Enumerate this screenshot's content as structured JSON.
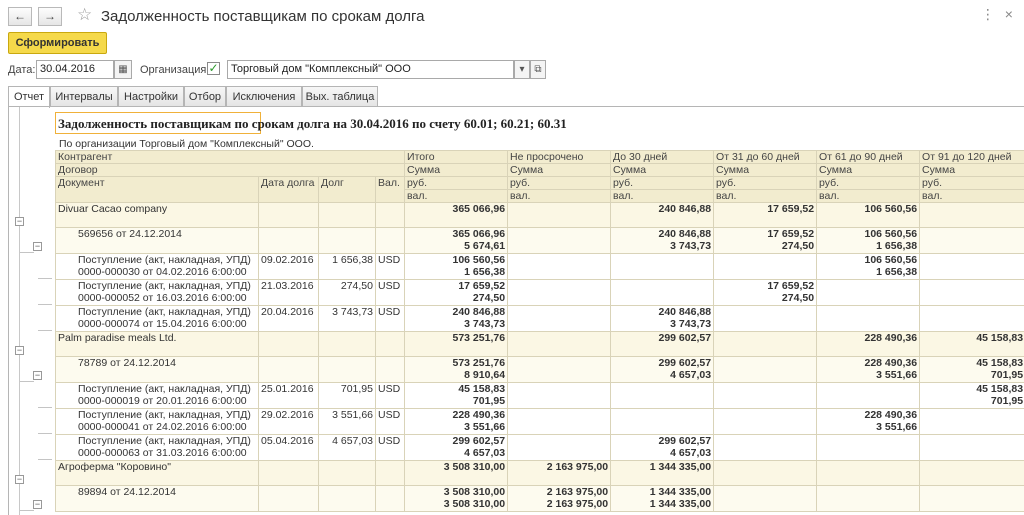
{
  "window": {
    "back_icon": "arrow-left-icon",
    "fwd_icon": "arrow-right-icon",
    "title": "Задолженность поставщикам по срокам долга"
  },
  "toolbar": {
    "generate_label": "Сформировать"
  },
  "filters": {
    "date_label": "Дата:",
    "date_value": "30.04.2016",
    "org_label": "Организация:",
    "org_value": "Торговый дом \"Комплексный\" ООО"
  },
  "tabs": [
    "Отчет",
    "Интервалы",
    "Настройки",
    "Отбор",
    "Исключения",
    "Вых. таблица"
  ],
  "report": {
    "title": "Задолженность поставщикам по срокам долга на 30.04.2016  по счету 60.01; 60.21; 60.31",
    "subtitle": "По организации Торговый дом \"Комплексный\" ООО.",
    "header": {
      "row1": [
        "Контрагент",
        "Итого",
        "Не просрочено",
        "До 30 дней",
        "От 31 до 60 дней",
        "От 61 до 90 дней",
        "От 91 до 120 дней"
      ],
      "row2": [
        "Договор",
        "Сумма",
        "Сумма",
        "Сумма",
        "Сумма",
        "Сумма",
        "Сумма"
      ],
      "row3": [
        "Документ",
        "Дата долга",
        "Долг",
        "Вал.",
        "руб.",
        "руб.",
        "руб.",
        "руб.",
        "руб.",
        "руб."
      ],
      "row4": [
        "вал.",
        "вал.",
        "вал.",
        "вал.",
        "вал.",
        "вал."
      ]
    },
    "rows": [
      {
        "t": "g1",
        "c": [
          "Divuar Cacao company",
          "",
          "",
          "",
          "365 066,96",
          "",
          "240 846,88",
          "17 659,52",
          "106 560,56",
          ""
        ]
      },
      {
        "t": "g2",
        "c": [
          "569656 от 24.12.2014",
          "",
          "",
          "",
          "365 066,96\n5 674,61",
          "",
          "240 846,88\n3 743,73",
          "17 659,52\n274,50",
          "106 560,56\n1 656,38",
          ""
        ]
      },
      {
        "t": "d",
        "c": [
          "Поступление (акт, накладная, УПД)\n0000-000030 от 04.02.2016 6:00:00",
          "09.02.2016",
          "1 656,38",
          "USD",
          "106 560,56\n1 656,38",
          "",
          "",
          "",
          "106 560,56\n1 656,38",
          ""
        ]
      },
      {
        "t": "d",
        "c": [
          "Поступление (акт, накладная, УПД)\n0000-000052 от 16.03.2016 6:00:00",
          "21.03.2016",
          "274,50",
          "USD",
          "17 659,52\n274,50",
          "",
          "",
          "17 659,52\n274,50",
          "",
          ""
        ]
      },
      {
        "t": "d",
        "c": [
          "Поступление (акт, накладная, УПД)\n0000-000074 от 15.04.2016 6:00:00",
          "20.04.2016",
          "3 743,73",
          "USD",
          "240 846,88\n3 743,73",
          "",
          "240 846,88\n3 743,73",
          "",
          "",
          ""
        ]
      },
      {
        "t": "g1",
        "c": [
          "Palm paradise meals Ltd.",
          "",
          "",
          "",
          "573 251,76",
          "",
          "299 602,57",
          "",
          "228 490,36",
          "45 158,83"
        ]
      },
      {
        "t": "g2",
        "c": [
          "78789 от 24.12.2014",
          "",
          "",
          "",
          "573 251,76\n8 910,64",
          "",
          "299 602,57\n4 657,03",
          "",
          "228 490,36\n3 551,66",
          "45 158,83\n701,95"
        ]
      },
      {
        "t": "d",
        "c": [
          "Поступление (акт, накладная, УПД)\n0000-000019 от 20.01.2016 6:00:00",
          "25.01.2016",
          "701,95",
          "USD",
          "45 158,83\n701,95",
          "",
          "",
          "",
          "",
          "45 158,83\n701,95"
        ]
      },
      {
        "t": "d",
        "c": [
          "Поступление (акт, накладная, УПД)\n0000-000041 от 24.02.2016 6:00:00",
          "29.02.2016",
          "3 551,66",
          "USD",
          "228 490,36\n3 551,66",
          "",
          "",
          "",
          "228 490,36\n3 551,66",
          ""
        ]
      },
      {
        "t": "d",
        "c": [
          "Поступление (акт, накладная, УПД)\n0000-000063 от 31.03.2016 6:00:00",
          "05.04.2016",
          "4 657,03",
          "USD",
          "299 602,57\n4 657,03",
          "",
          "299 602,57\n4 657,03",
          "",
          "",
          ""
        ]
      },
      {
        "t": "g1",
        "c": [
          "Агроферма \"Коровино\"",
          "",
          "",
          "",
          "3 508 310,00",
          "2 163 975,00",
          "1 344 335,00",
          "",
          "",
          ""
        ]
      },
      {
        "t": "g2",
        "c": [
          "89894 от 24.12.2014",
          "",
          "",
          "",
          "3 508 310,00\n3 508 310,00",
          "2 163 975,00\n2 163 975,00",
          "1 344 335,00\n1 344 335,00",
          "",
          "",
          ""
        ]
      }
    ]
  }
}
